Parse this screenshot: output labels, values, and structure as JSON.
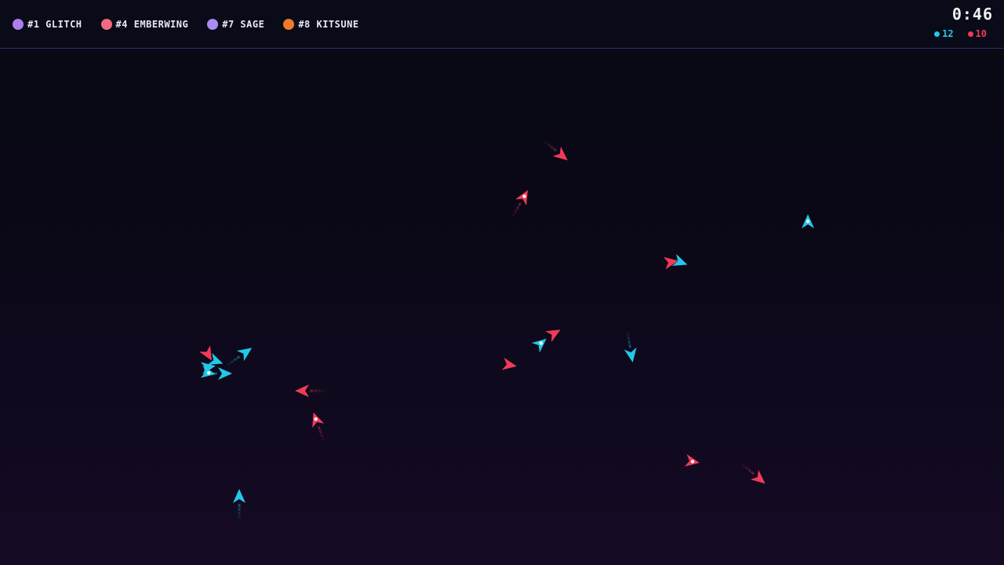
{
  "hud": {
    "players": [
      {
        "label": "#1 GLITCH",
        "color": "#b07cf0"
      },
      {
        "label": "#4 EMBERWING",
        "color": "#f06a80"
      },
      {
        "label": "#7 SAGE",
        "color": "#a98cf0"
      },
      {
        "label": "#8 KITSUNE",
        "color": "#f07a2a"
      }
    ],
    "timer": "0:46",
    "scores": {
      "cyan": {
        "value": "12",
        "color": "#22c8e8"
      },
      "red": {
        "value": "10",
        "color": "#f03a58"
      }
    }
  },
  "colors": {
    "cyan_team": "#22c8e8",
    "red_team": "#f03a58"
  }
}
